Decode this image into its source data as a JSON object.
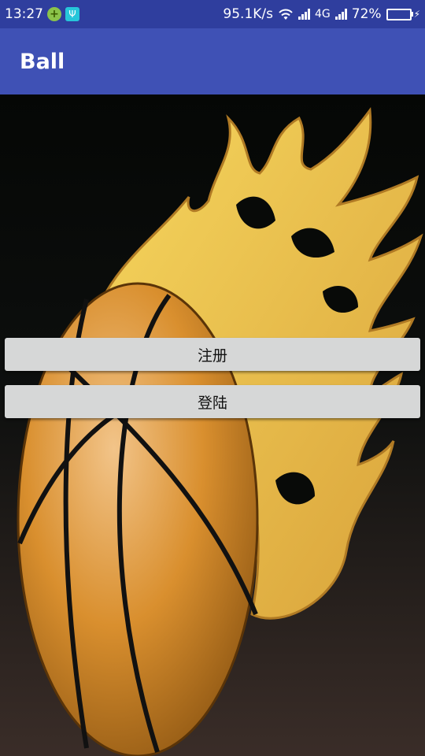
{
  "status_bar": {
    "time": "13:27",
    "speed": "95.1K/s",
    "network": "4G",
    "battery": "72%",
    "battery_level": 0.72
  },
  "app_bar": {
    "title": "Ball"
  },
  "buttons": {
    "register": "注册",
    "login": "登陆"
  },
  "colors": {
    "status_bar": "#2f3e9e",
    "app_bar": "#3f51b5",
    "button": "#d6d7d7",
    "ball": "#d98f2e",
    "flame": "#f3cc55"
  }
}
